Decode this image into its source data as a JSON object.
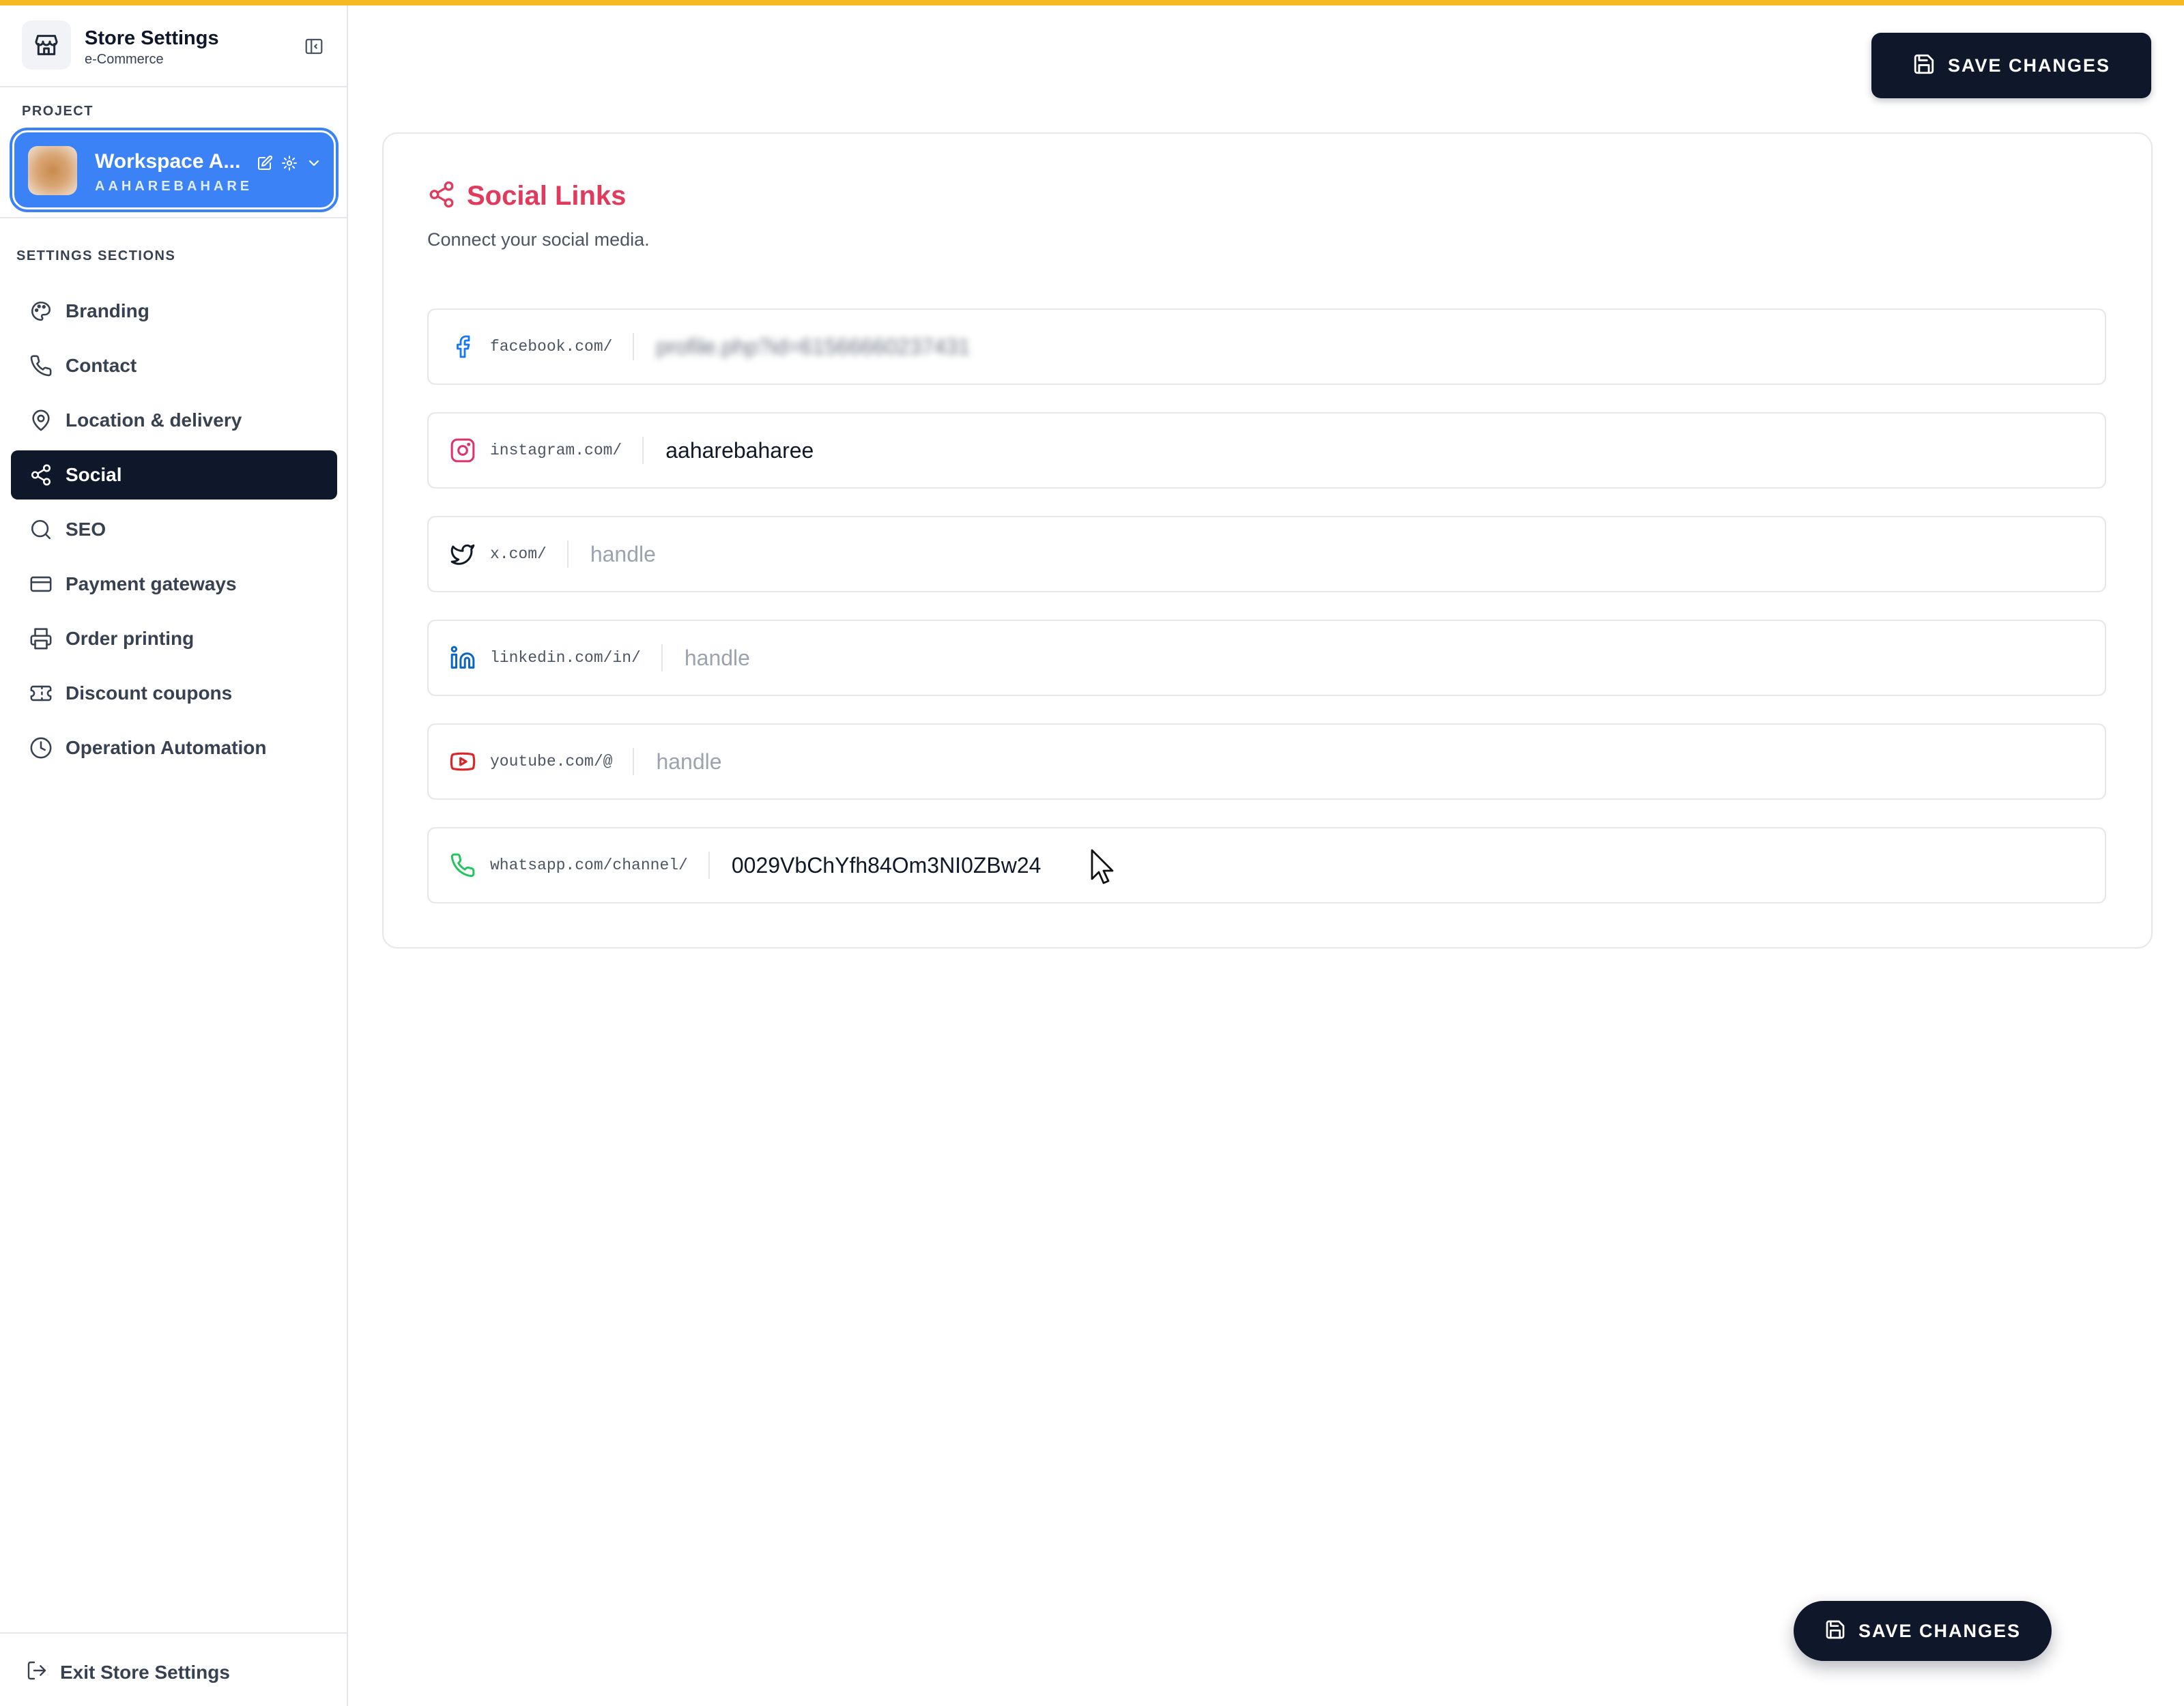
{
  "app": {
    "title": "Store Settings",
    "subtitle": "e-Commerce"
  },
  "project": {
    "section_label": "PROJECT",
    "workspace_name": "Workspace A...",
    "workspace_handle": "AAHAREBAHARE"
  },
  "sidebar": {
    "section_label": "SETTINGS SECTIONS",
    "items": [
      {
        "label": "Branding",
        "icon": "palette-icon",
        "active": false
      },
      {
        "label": "Contact",
        "icon": "phone-icon",
        "active": false
      },
      {
        "label": "Location & delivery",
        "icon": "map-pin-icon",
        "active": false
      },
      {
        "label": "Social",
        "icon": "share-icon",
        "active": true
      },
      {
        "label": "SEO",
        "icon": "search-icon",
        "active": false
      },
      {
        "label": "Payment gateways",
        "icon": "credit-card-icon",
        "active": false
      },
      {
        "label": "Order printing",
        "icon": "printer-icon",
        "active": false
      },
      {
        "label": "Discount coupons",
        "icon": "ticket-icon",
        "active": false
      },
      {
        "label": "Operation Automation",
        "icon": "clock-icon",
        "active": false
      }
    ],
    "exit_label": "Exit Store Settings"
  },
  "toolbar": {
    "save_label": "SAVE CHANGES"
  },
  "social": {
    "title": "Social Links",
    "subtitle": "Connect your social media.",
    "fields": {
      "facebook": {
        "prefix": "facebook.com/",
        "value": "profile.php?id=61566660237431",
        "placeholder": "handle",
        "color": "#1877f2"
      },
      "instagram": {
        "prefix": "instagram.com/",
        "value": "aaharebaharee",
        "placeholder": "handle",
        "color": "#e1306c"
      },
      "x": {
        "prefix": "x.com/",
        "value": "",
        "placeholder": "handle",
        "color": "#111827"
      },
      "linkedin": {
        "prefix": "linkedin.com/in/",
        "value": "",
        "placeholder": "handle",
        "color": "#0a66c2"
      },
      "youtube": {
        "prefix": "youtube.com/@",
        "value": "",
        "placeholder": "handle",
        "color": "#dc2626"
      },
      "whatsapp": {
        "prefix": "whatsapp.com/channel/",
        "value": "0029VbChYfh84Om3NI0ZBw24",
        "placeholder": "handle",
        "color": "#22c55e"
      }
    }
  },
  "floating": {
    "save_label": "SAVE CHANGES"
  },
  "colors": {
    "accent": "#f5b922",
    "primary_dark": "#0f172a",
    "workspace_blue": "#3b82f6",
    "social_title": "#e23a5c"
  }
}
